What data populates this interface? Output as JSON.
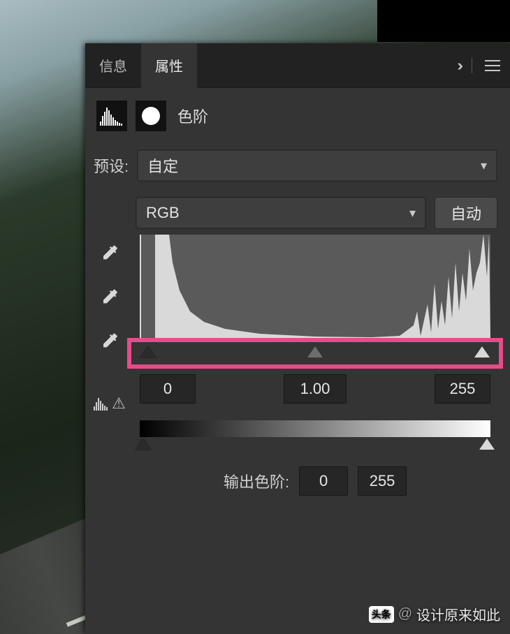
{
  "tabs": {
    "info": "信息",
    "props": "属性"
  },
  "icons": {
    "more": "››",
    "menu": "≡"
  },
  "header": {
    "title": "色阶"
  },
  "preset": {
    "label": "预设:",
    "value": "自定"
  },
  "channel": {
    "value": "RGB"
  },
  "buttons": {
    "auto": "自动"
  },
  "input_levels": {
    "shadow": "0",
    "mid": "1.00",
    "highlight": "255"
  },
  "output": {
    "label": "输出色阶:",
    "low": "0",
    "high": "255"
  },
  "watermark": {
    "badge": "头条",
    "at": "@",
    "name": "设计原来如此"
  }
}
